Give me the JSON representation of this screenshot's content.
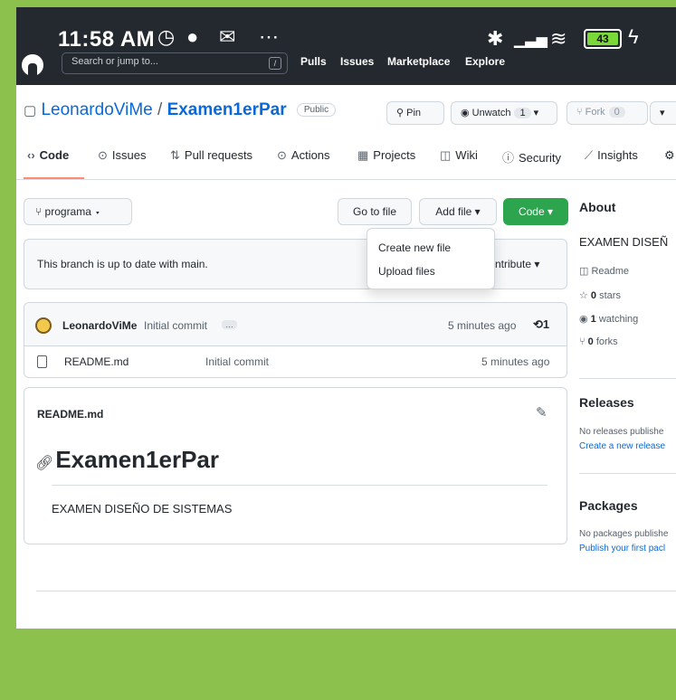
{
  "status_bar": {
    "time": "11:58 AM",
    "battery": "43"
  },
  "gh_header": {
    "search_placeholder": "Search or jump to...",
    "search_key": "/",
    "nav": [
      "Pulls",
      "Issues",
      "Marketplace",
      "Explore"
    ]
  },
  "repo": {
    "owner": "LeonardoViMe",
    "separator": " / ",
    "name": "Examen1erPar",
    "visibility": "Public",
    "pin_label": "Pin",
    "unwatch_label": "Unwatch",
    "unwatch_count": "1",
    "fork_label": "Fork",
    "fork_count": "0"
  },
  "tabs": [
    {
      "label": "Code",
      "icon": "code-icon"
    },
    {
      "label": "Issues",
      "icon": "issues-icon"
    },
    {
      "label": "Pull requests",
      "icon": "pull-request-icon"
    },
    {
      "label": "Actions",
      "icon": "actions-icon"
    },
    {
      "label": "Projects",
      "icon": "projects-icon"
    },
    {
      "label": "Wiki",
      "icon": "wiki-icon"
    },
    {
      "label": "Security",
      "icon": "security-icon"
    },
    {
      "label": "Insights",
      "icon": "insights-icon"
    }
  ],
  "toolbar": {
    "branch": "programa",
    "goto_file": "Go to file",
    "add_file": "Add file",
    "code": "Code"
  },
  "add_file_menu": [
    "Create new file",
    "Upload files"
  ],
  "branch_info": {
    "text": "This branch is up to date with main.",
    "contribute": "ntribute"
  },
  "commit": {
    "author": "LeonardoViMe",
    "message": "Initial commit",
    "time": "5 minutes ago",
    "count": "1"
  },
  "files": [
    {
      "name": "README.md",
      "commit": "Initial commit",
      "time": "5 minutes ago"
    }
  ],
  "readme": {
    "label": "README.md",
    "heading": "Examen1erPar",
    "body": "EXAMEN DISEÑO DE SISTEMAS"
  },
  "sidebar": {
    "about_title": "About",
    "description": "EXAMEN DISEÑ",
    "readme": "Readme",
    "stars_count": "0",
    "stars_label": "stars",
    "watching_count": "1",
    "watching_label": "watching",
    "forks_count": "0",
    "forks_label": "forks",
    "releases_title": "Releases",
    "releases_text": "No releases publishe",
    "releases_link": "Create a new release",
    "packages_title": "Packages",
    "packages_text": "No packages publishe",
    "packages_link": "Publish your first pacl"
  }
}
